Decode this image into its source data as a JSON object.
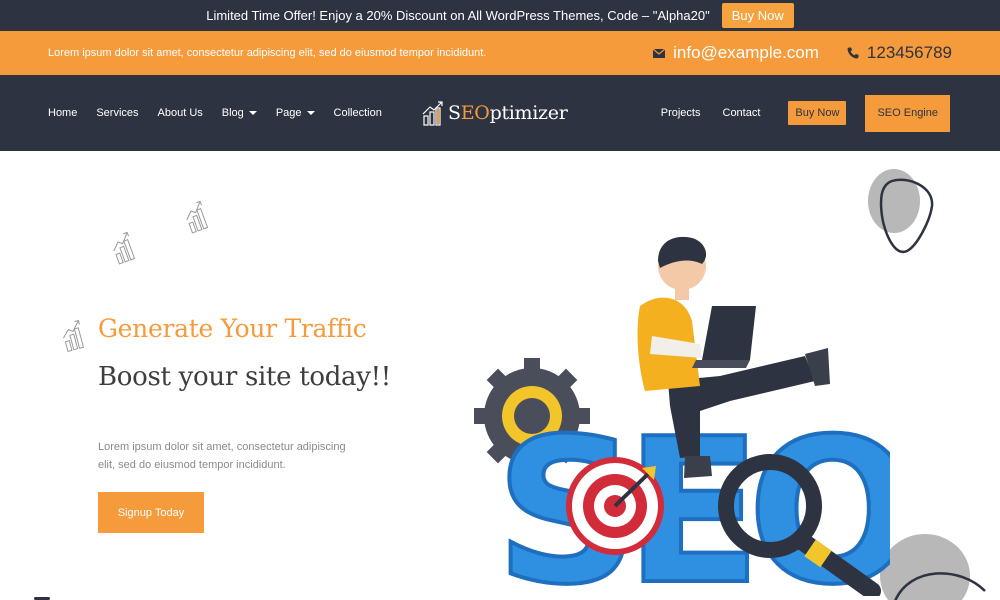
{
  "promo": {
    "text": "Limited Time Offer! Enjoy a 20% Discount on All WordPress Themes, Code – \"Alpha20\"",
    "button": "Buy Now"
  },
  "contact": {
    "text": "Lorem ipsum dolor sit amet, consectetur adipiscing elit, sed do eiusmod tempor incididunt.",
    "email": "info@example.com",
    "phone": "123456789"
  },
  "nav": {
    "left": [
      {
        "label": "Home"
      },
      {
        "label": "Services"
      },
      {
        "label": "About Us"
      },
      {
        "label": "Blog",
        "dropdown": true
      },
      {
        "label": "Page",
        "dropdown": true
      },
      {
        "label": "Collection"
      }
    ],
    "logo": {
      "first": "S",
      "accent": "EO",
      "rest": "ptimizer"
    },
    "right": [
      {
        "label": "Projects"
      },
      {
        "label": "Contact"
      }
    ],
    "buy_now": "Buy Now",
    "seo_engine": "SEO Engine"
  },
  "hero": {
    "title": "Generate Your Traffic",
    "subtitle": "Boost your site today!!",
    "description": "Lorem ipsum dolor sit amet, consectetur adipiscing elit, sed do eiusmod tempor incididunt.",
    "cta": "Signup Today",
    "illustration_text": "SEO"
  },
  "colors": {
    "dark": "#2d3340",
    "accent": "#f59b3b",
    "seo_blue": "#2f8fe0"
  }
}
